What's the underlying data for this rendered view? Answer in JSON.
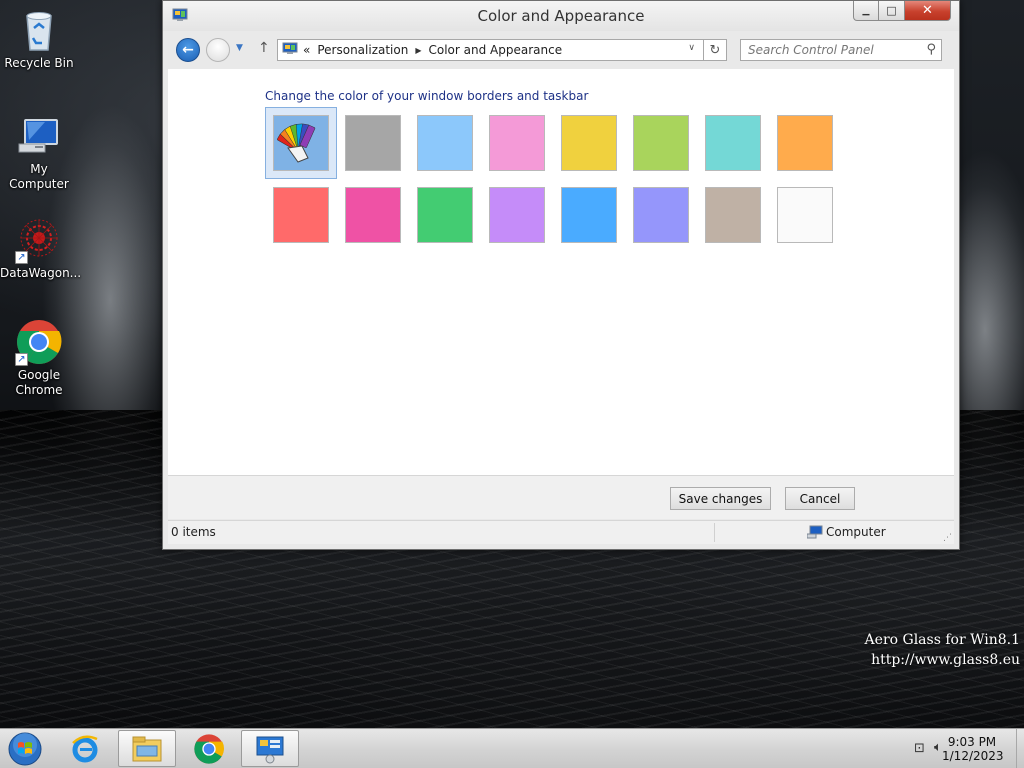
{
  "desktop": {
    "icons": [
      {
        "label": "Recycle Bin",
        "icon": "recycle-bin-icon"
      },
      {
        "label": "My Computer",
        "icon": "computer-icon"
      },
      {
        "label": "DataWagon...",
        "icon": "datawagon-icon"
      },
      {
        "label": "Google Chrome",
        "icon": "chrome-icon"
      }
    ],
    "watermark": {
      "line1": "Aero Glass for Win8.1",
      "line2": "http://www.glass8.eu"
    }
  },
  "window": {
    "title": "Color and Appearance",
    "controls": {
      "minimize": "▁",
      "maximize": "□",
      "close": "✕"
    },
    "address": {
      "prefix": "«",
      "crumbs": [
        "Personalization",
        "Color and Appearance"
      ],
      "sep": "▶"
    },
    "search": {
      "placeholder": "Search Control Panel"
    },
    "heading": "Change the color of your window borders and taskbar",
    "swatches": [
      {
        "name": "automatic",
        "color": "#7fb2e5",
        "selected": true
      },
      {
        "name": "gray",
        "color": "#a6a6a6"
      },
      {
        "name": "sky-blue",
        "color": "#8cc8fb"
      },
      {
        "name": "pink",
        "color": "#f49ad7"
      },
      {
        "name": "yellow",
        "color": "#f0d13e"
      },
      {
        "name": "lime",
        "color": "#a9d45c"
      },
      {
        "name": "teal",
        "color": "#74d8d6"
      },
      {
        "name": "orange",
        "color": "#ffab4c"
      },
      {
        "name": "red",
        "color": "#ff6a6a"
      },
      {
        "name": "magenta",
        "color": "#ef52a5"
      },
      {
        "name": "green",
        "color": "#43cc72"
      },
      {
        "name": "violet",
        "color": "#c58cf9"
      },
      {
        "name": "blue",
        "color": "#4aabff"
      },
      {
        "name": "periwinkle",
        "color": "#9596fb"
      },
      {
        "name": "taupe",
        "color": "#bfb1a5"
      },
      {
        "name": "white",
        "color": "#fafafa"
      }
    ],
    "buttons": {
      "save": "Save changes",
      "cancel": "Cancel"
    },
    "status": {
      "items": "0 items",
      "location": "Computer"
    }
  },
  "taskbar": {
    "apps": [
      "internet-explorer-icon",
      "file-explorer-icon",
      "chrome-icon",
      "control-panel-icon"
    ],
    "clock": {
      "time": "9:03 PM",
      "date": "1/12/2023"
    }
  }
}
